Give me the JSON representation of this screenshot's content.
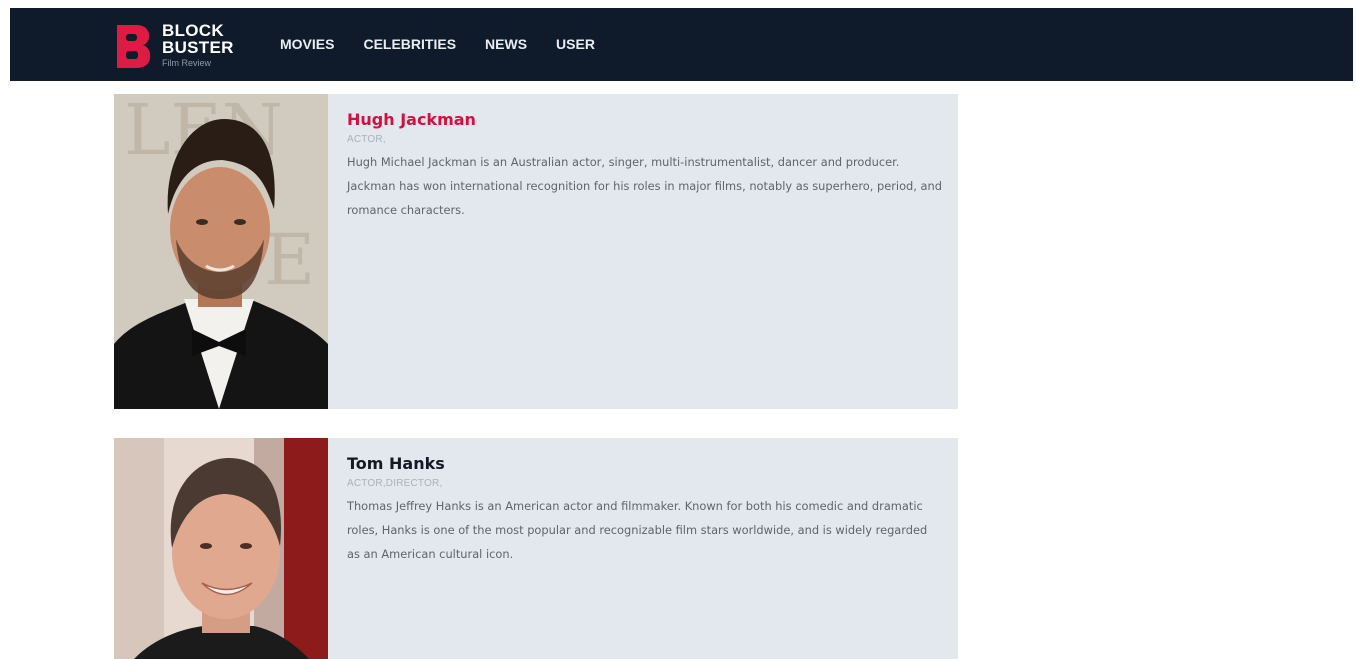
{
  "brand": {
    "line1": "BLOCK",
    "line2": "BUSTER",
    "tagline": "Film Review",
    "color": "#dd1b45"
  },
  "nav": {
    "items": [
      "MOVIES",
      "CELEBRITIES",
      "NEWS",
      "USER"
    ]
  },
  "celebrities": [
    {
      "name": "Hugh Jackman",
      "roles": "ACTOR,",
      "bio": "Hugh Michael Jackman is an Australian actor, singer, multi-instrumentalist, dancer and producer. Jackman has won international recognition for his roles in major films, notably as superhero, period, and romance characters."
    },
    {
      "name": "Tom Hanks",
      "roles": "ACTOR,DIRECTOR,",
      "bio": "Thomas Jeffrey Hanks is an American actor and filmmaker. Known for both his comedic and dramatic roles, Hanks is one of the most popular and recognizable film stars worldwide, and is widely regarded as an American cultural icon."
    }
  ],
  "colors": {
    "navbar": "#0f1b2a",
    "card": "#e3e8ef",
    "accent": "#d4103f"
  }
}
